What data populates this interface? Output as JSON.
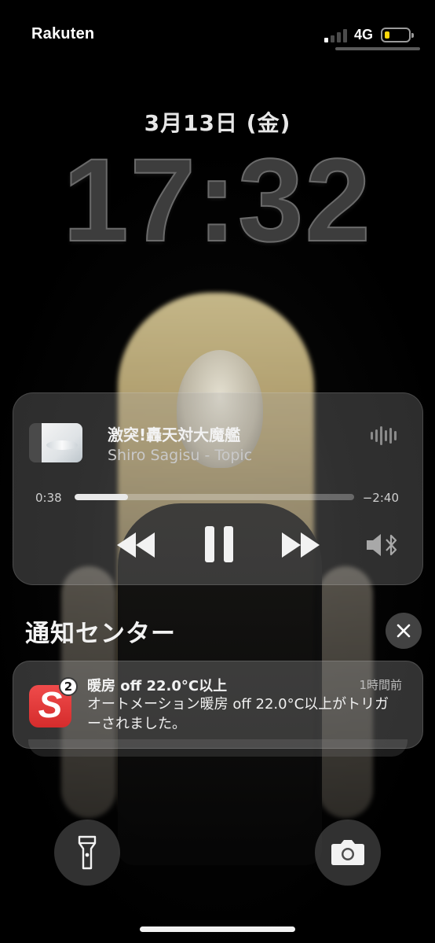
{
  "status_bar": {
    "carrier": "Rakuten",
    "network": "4G",
    "signal_bars_active": 1,
    "battery_level": 0.2,
    "battery_color": "#ffd60a"
  },
  "lock": {
    "date": "3月13日 (金)",
    "time": "17:32"
  },
  "player": {
    "track_title": "激突!轟天対大魔艦",
    "artist": "Shiro Sagisu - Topic",
    "elapsed": "0:38",
    "remaining": "−2:40",
    "progress": 0.19,
    "icons": {
      "waveform": "waveform-icon",
      "rewind": "rewind-icon",
      "pause": "pause-icon",
      "fast_forward": "fast-forward-icon",
      "audio_output": "bluetooth-speaker-icon"
    }
  },
  "notification_center": {
    "title": "通知センター",
    "close_icon": "close-icon"
  },
  "notifications": [
    {
      "app_icon_letter": "S",
      "app_icon_color": "#e03a3a",
      "badge": "2",
      "title": "暖房 off 22.0°C以上",
      "time": "1時間前",
      "body": "オートメーション暖房 off 22.0°C以上がトリガーされました。"
    }
  ],
  "quick_actions": {
    "flashlight": "flashlight-icon",
    "camera": "camera-icon"
  }
}
